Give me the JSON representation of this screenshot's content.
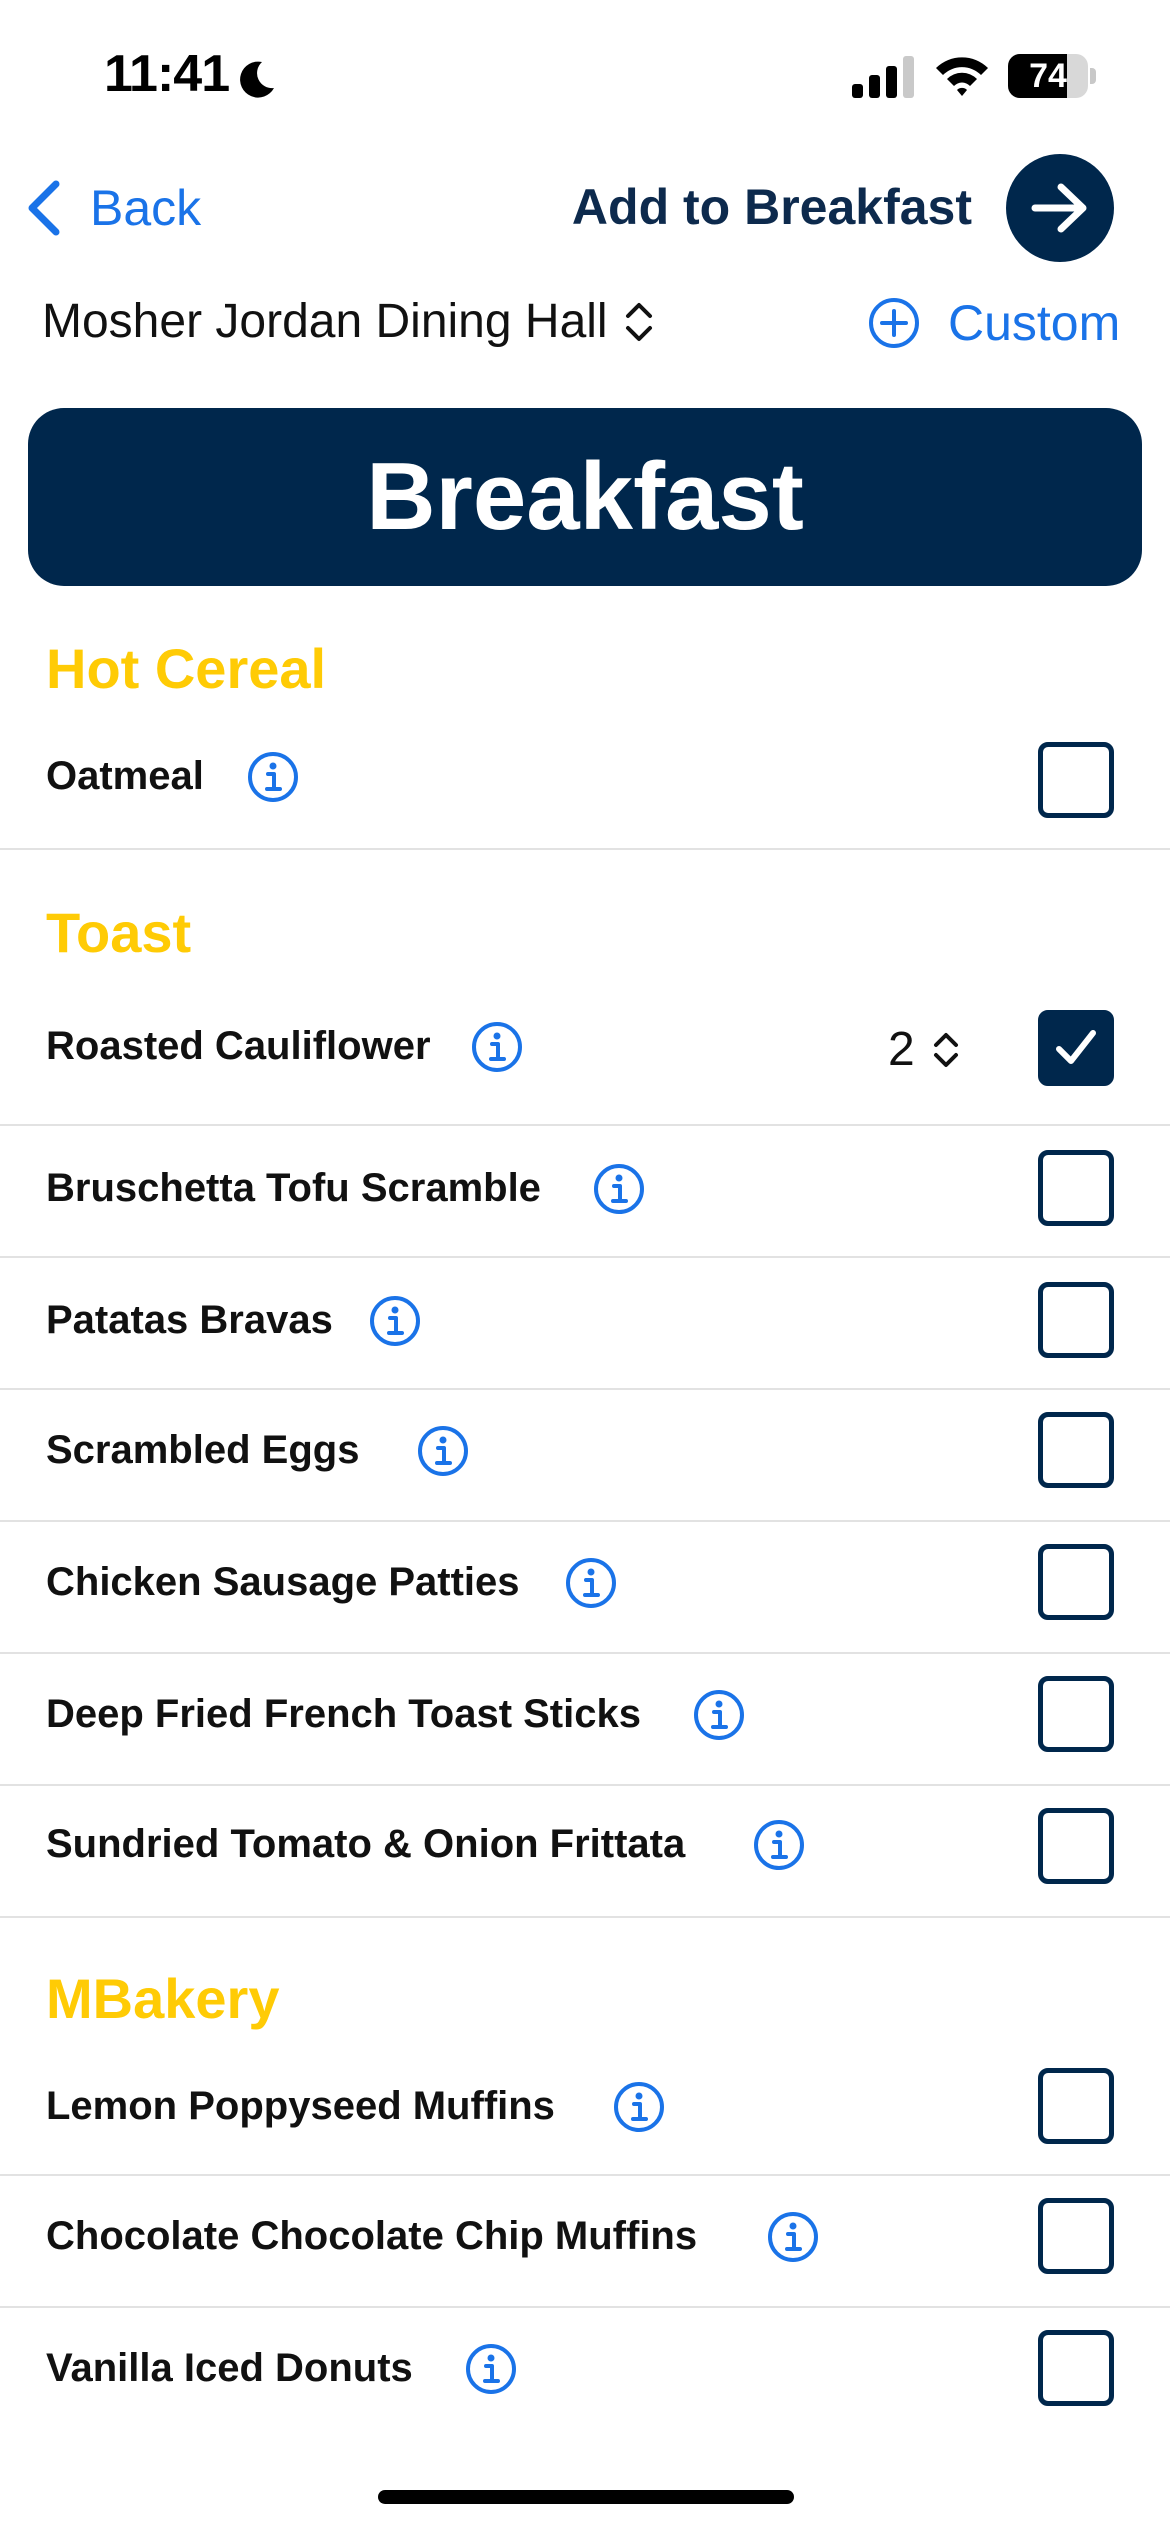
{
  "status_bar": {
    "time": "11:41",
    "battery": "74",
    "battery_level": 0.74
  },
  "nav": {
    "back_label": "Back",
    "title": "Add to Breakfast"
  },
  "location": {
    "hall_name": "Mosher Jordan Dining Hall",
    "custom_label": "Custom"
  },
  "meal": {
    "banner": "Breakfast"
  },
  "sections": [
    {
      "title": "Hot Cereal",
      "items": [
        {
          "name": "Oatmeal",
          "checked": false
        }
      ]
    },
    {
      "title": "Toast",
      "items": [
        {
          "name": "Roasted Cauliflower",
          "checked": true,
          "quantity": "2"
        },
        {
          "name": "Bruschetta Tofu Scramble",
          "checked": false
        },
        {
          "name": "Patatas Bravas",
          "checked": false
        },
        {
          "name": "Scrambled Eggs",
          "checked": false
        },
        {
          "name": "Chicken Sausage Patties",
          "checked": false
        },
        {
          "name": "Deep Fried French Toast Sticks",
          "checked": false
        },
        {
          "name": "Sundried Tomato & Onion Frittata",
          "checked": false
        }
      ]
    },
    {
      "title": "MBakery",
      "items": [
        {
          "name": "Lemon Poppyseed Muffins",
          "checked": false
        },
        {
          "name": "Chocolate Chocolate Chip Muffins",
          "checked": false
        },
        {
          "name": "Vanilla Iced Donuts",
          "checked": false
        }
      ]
    }
  ],
  "colors": {
    "primary_navy": "#00274c",
    "accent_maize": "#ffcb05",
    "link_blue": "#1a73e8"
  }
}
